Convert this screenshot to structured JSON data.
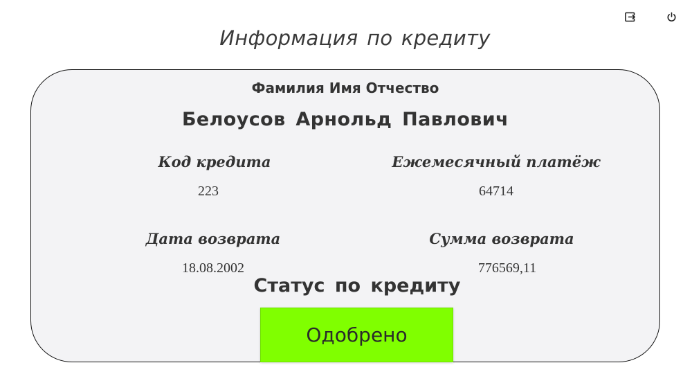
{
  "header": {
    "title": "Информация по кредиту",
    "icons": {
      "logout": "logout-icon",
      "power": "power-icon"
    }
  },
  "card": {
    "fio_label": "Фамилия Имя Отчество",
    "fio_value": "Белоусов Арнольд Павлович",
    "credit_code": {
      "label": "Код кредита",
      "value": "223"
    },
    "monthly_payment": {
      "label": "Ежемесячный платёж",
      "value": "64714"
    },
    "return_date": {
      "label": "Дата возврата",
      "value": "18.08.2002"
    },
    "return_sum": {
      "label": "Сумма возврата",
      "value": "776569,11"
    },
    "status_label": "Статус по кредиту",
    "status_value": "Одобрено"
  },
  "colors": {
    "card_background": "#f3f3f5",
    "status_approved": "#80ff00",
    "text": "#333333"
  }
}
